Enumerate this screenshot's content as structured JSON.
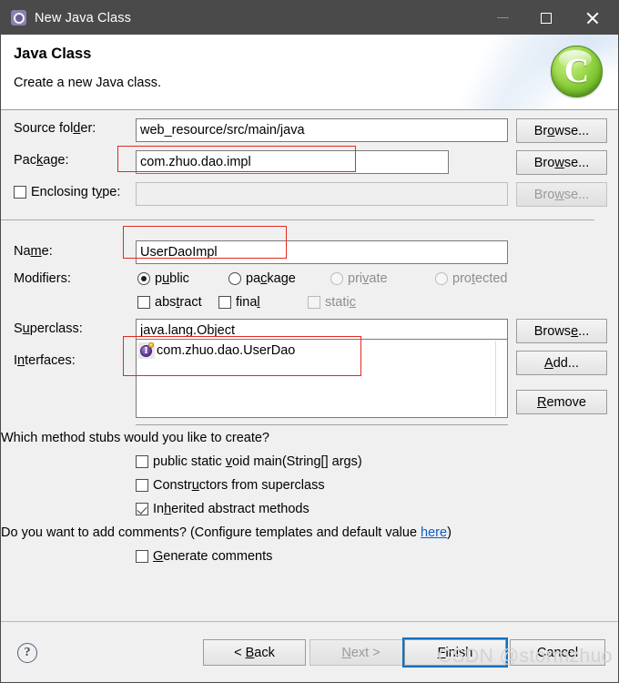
{
  "window": {
    "title": "New Java Class",
    "icon": "gear-icon",
    "minimize": "—",
    "maximize": "□",
    "close": "✕"
  },
  "header": {
    "title": "Java Class",
    "subtitle": "Create a new Java class.",
    "logo_letter": "C"
  },
  "form": {
    "source_folder": {
      "label_pre": "Source fol",
      "label_mnemonic": "d",
      "label_post": "er:",
      "value": "web_resource/src/main/java",
      "button_pre": "Br",
      "button_mnemonic": "o",
      "button_post": "wse..."
    },
    "package": {
      "label_pre": "Pac",
      "label_mnemonic": "k",
      "label_post": "age:",
      "value": "com.zhuo.dao.impl",
      "button_pre": "Bro",
      "button_mnemonic": "w",
      "button_post": "se..."
    },
    "enclosing_type": {
      "label_pre": "Enclosing t",
      "label_mnemonic": "y",
      "label_post": "pe:",
      "value": "",
      "checked": false,
      "button_pre": "Bro",
      "button_mnemonic": "w",
      "button_post": "se...",
      "disabled": true
    },
    "name": {
      "label_pre": "Na",
      "label_mnemonic": "m",
      "label_post": "e:",
      "value": "UserDaoImpl"
    },
    "modifiers": {
      "label": "Modifiers:",
      "radios": [
        {
          "pre": "p",
          "mn": "u",
          "post": "blic",
          "selected": true,
          "disabled": false
        },
        {
          "pre": "pa",
          "mn": "c",
          "post": "kage",
          "selected": false,
          "disabled": false
        },
        {
          "pre": "pri",
          "mn": "v",
          "post": "ate",
          "selected": false,
          "disabled": true
        },
        {
          "pre": "pro",
          "mn": "t",
          "post": "ected",
          "selected": false,
          "disabled": true
        }
      ],
      "checkboxes": [
        {
          "pre": "abs",
          "mn": "t",
          "post": "ract",
          "checked": false,
          "disabled": false
        },
        {
          "pre": "fina",
          "mn": "l",
          "post": "",
          "checked": false,
          "disabled": false
        },
        {
          "pre": "stati",
          "mn": "c",
          "post": "",
          "checked": false,
          "disabled": true
        }
      ]
    },
    "superclass": {
      "label_pre": "S",
      "label_mnemonic": "u",
      "label_post": "perclass:",
      "value": "java.lang.Object",
      "button_pre": "Brows",
      "button_mnemonic": "e",
      "button_post": "..."
    },
    "interfaces": {
      "label_pre": "I",
      "label_mnemonic": "n",
      "label_post": "terfaces:",
      "items": [
        {
          "icon": "java-interface-icon",
          "text": "com.zhuo.dao.UserDao"
        }
      ],
      "add_pre": "",
      "add_mnemonic": "A",
      "add_post": "dd...",
      "remove_pre": "",
      "remove_mnemonic": "R",
      "remove_post": "emove"
    }
  },
  "stubs": {
    "question": "Which method stubs would you like to create?",
    "options": [
      {
        "pre": "public static ",
        "mn": "v",
        "post": "oid main(String[] args)",
        "checked": false
      },
      {
        "pre": "Constr",
        "mn": "u",
        "post": "ctors from superclass",
        "checked": false
      },
      {
        "pre": "In",
        "mn": "h",
        "post": "erited abstract methods",
        "checked": true
      }
    ]
  },
  "comments": {
    "question_pre": "Do you want to add comments? (Configure templates and default value ",
    "link": "here",
    "question_post": ")",
    "option": {
      "pre": "",
      "mn": "G",
      "post": "enerate comments",
      "checked": false
    }
  },
  "footer": {
    "help": "?",
    "back_pre": "< ",
    "back_mn": "B",
    "back_post": "ack",
    "next_pre": "",
    "next_mn": "N",
    "next_post": "ext >",
    "next_disabled": true,
    "finish_pre": "",
    "finish_mn": "F",
    "finish_post": "inish",
    "finish_focused": true,
    "cancel": "Cancel",
    "watermark": "CSDN @stormzhuo"
  },
  "colors": {
    "titlebar": "#4a4a4a",
    "dialog_bg": "#f0f0f0",
    "annotation_red": "#e2291f",
    "focus_blue": "#0a72c4",
    "link_blue": "#0b5ec7",
    "logo_green": "#7dc52f"
  }
}
